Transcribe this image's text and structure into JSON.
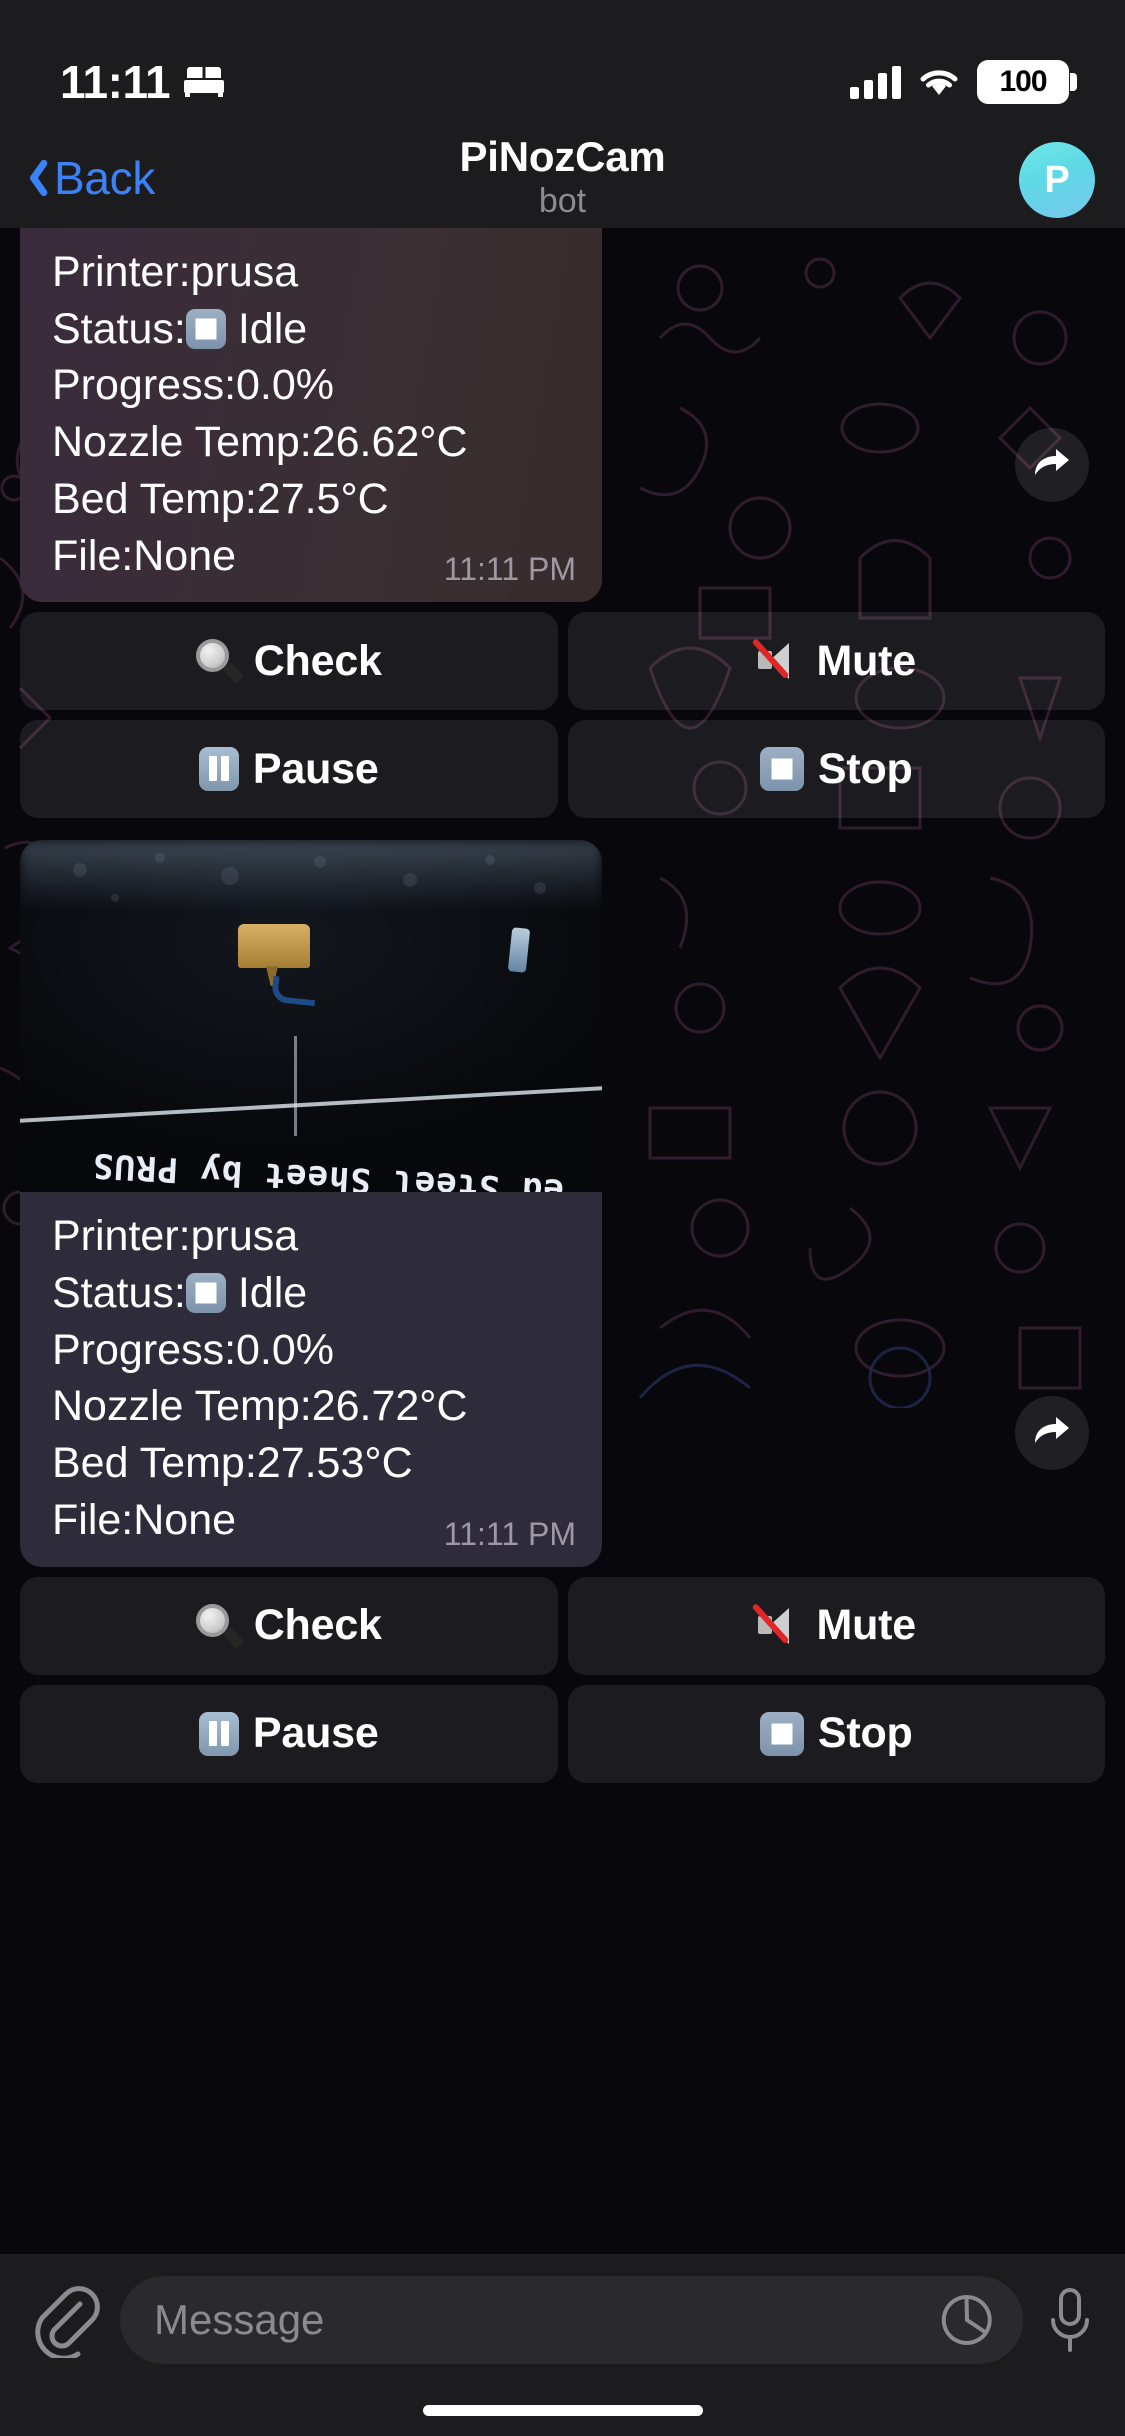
{
  "status_bar": {
    "time": "11:11",
    "bed_icon": "bed-icon",
    "signal_icon": "cellular-signal-icon",
    "wifi_icon": "wifi-icon",
    "battery_level": "100"
  },
  "nav": {
    "back_label": "Back",
    "back_icon": "chevron-left-icon",
    "title": "PiNozCam",
    "subtitle": "bot",
    "avatar_initial": "P"
  },
  "messages": [
    {
      "has_photo": false,
      "lines": [
        {
          "label": "Printer: ",
          "emoji": "",
          "value": "prusa"
        },
        {
          "label": "Status: ",
          "emoji": "stop-square-emoji",
          "value": "Idle"
        },
        {
          "label": "Progress: ",
          "emoji": "",
          "value": "0.0%"
        },
        {
          "label": "Nozzle Temp: ",
          "emoji": "",
          "value": "26.62°C"
        },
        {
          "label": "Bed Temp: ",
          "emoji": "",
          "value": "27.5°C"
        },
        {
          "label": "File: ",
          "emoji": "",
          "value": "None"
        }
      ],
      "time": "11:11 PM",
      "forward_icon": "forward-arrow-icon",
      "keyboard": [
        [
          {
            "icon": "magnifying-glass-emoji",
            "label": "Check"
          },
          {
            "icon": "muted-speaker-emoji",
            "label": "Mute"
          }
        ],
        [
          {
            "icon": "pause-button-emoji",
            "label": "Pause"
          },
          {
            "icon": "stop-button-emoji",
            "label": "Stop"
          }
        ]
      ]
    },
    {
      "has_photo": true,
      "photo_caption_text": "ed Steel Sheet by PRUS",
      "lines": [
        {
          "label": "Printer: ",
          "emoji": "",
          "value": "prusa"
        },
        {
          "label": "Status: ",
          "emoji": "stop-square-emoji",
          "value": "Idle"
        },
        {
          "label": "Progress: ",
          "emoji": "",
          "value": "0.0%"
        },
        {
          "label": "Nozzle Temp: ",
          "emoji": "",
          "value": "26.72°C"
        },
        {
          "label": "Bed Temp: ",
          "emoji": "",
          "value": "27.53°C"
        },
        {
          "label": "File: ",
          "emoji": "",
          "value": "None"
        }
      ],
      "time": "11:11 PM",
      "forward_icon": "forward-arrow-icon",
      "keyboard": [
        [
          {
            "icon": "magnifying-glass-emoji",
            "label": "Check"
          },
          {
            "icon": "muted-speaker-emoji",
            "label": "Mute"
          }
        ],
        [
          {
            "icon": "pause-button-emoji",
            "label": "Pause"
          },
          {
            "icon": "stop-button-emoji",
            "label": "Stop"
          }
        ]
      ]
    }
  ],
  "input_bar": {
    "attach_icon": "paperclip-icon",
    "placeholder": "Message",
    "sticker_icon": "sticker-icon",
    "mic_icon": "microphone-icon"
  },
  "colors": {
    "accent_blue": "#3b82f6",
    "avatar": "#6fe8e8",
    "bubble_1": "#3a2b3c",
    "bubble_2": "#2e2b3a",
    "chrome": "#1c1b1e"
  }
}
